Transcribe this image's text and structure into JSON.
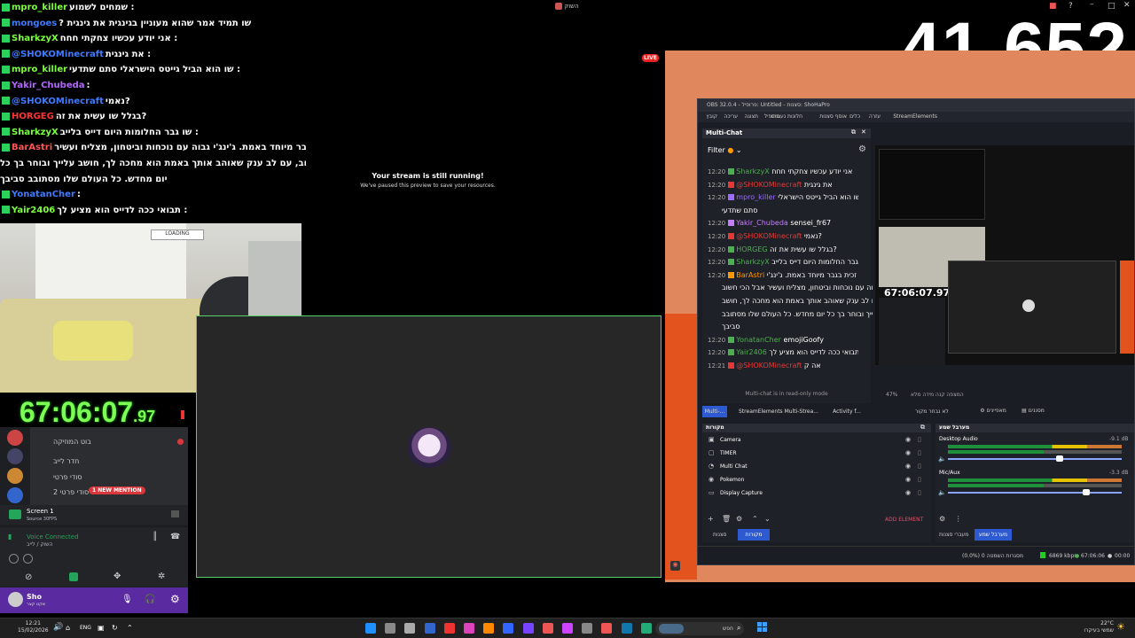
{
  "window": {
    "title": "השוק",
    "live_badge": "LIVE"
  },
  "chat": [
    {
      "name": "mpro_killer",
      "color": "#7cff3f",
      "msg": "שמחים לשמוע :"
    },
    {
      "name": "mongoes",
      "color": "#3f7bff",
      "msg": "? שו תמיד אמר שהוא מעוניין בגינגית את גינגית"
    },
    {
      "name": "SharkzyX",
      "color": "#7cff3f",
      "msg": "אני יודע עכשיו צחקתי חחח :"
    },
    {
      "name": "@SHOKOMinecraft",
      "color": "#3f7bff",
      "msg": "את גינגית :"
    },
    {
      "name": "mpro_killer",
      "color": "#7cff3f",
      "msg": "שו הוא הביל גייטס הישראלי סתם שתדעי :"
    },
    {
      "name": "Yakir_Chubeda",
      "color": "#b266ff",
      "msg": ":"
    },
    {
      "name": "@SHOKOMinecraft",
      "color": "#3f7bff",
      "msg": "נאמי?"
    },
    {
      "name": "HORGEG",
      "color": "#ff3333",
      "msg": "בגלל שו עשית את זה?"
    },
    {
      "name": "SharkzyX",
      "color": "#7cff3f",
      "msg": "שו גבר החלומות היום דייס בלייב :"
    },
    {
      "name": "BarAstri",
      "color": "#ff5555",
      "msg": "זכית בגבר מיוחד באמת. ג'ינג'י גבוה עם נוכחות וביטחון, מצליח ועשיר :"
    },
    {
      "name": "",
      "color": "#ffffff",
      "msg": "אבל הכי חשוב, עם לב ענק שאוהב אותך באמת הוא מחכה לך, חושב עלייך ובוחר בך כל"
    },
    {
      "name": "",
      "color": "#ffffff",
      "msg": "יום מחדש. כל העולם שלו מסתובב סביבך"
    },
    {
      "name": "YonatanCher",
      "color": "#3f7bff",
      "msg": ":"
    },
    {
      "name": "Yair2406",
      "color": "#7cff3f",
      "msg": "תבואי ככה לדייס הוא מציע לך :"
    }
  ],
  "webcam": {
    "overlay_label": "LOADING"
  },
  "viewer_count": "41,652",
  "timer": {
    "main": "67:06:07",
    "fraction": ".97"
  },
  "stream_status": {
    "title": "Your stream is still running!",
    "subtitle": "We've paused this preview to save your resources."
  },
  "discord": {
    "channel_items": [
      "בוט המוזיקה",
      "חדר לייב",
      "סודי פרטי",
      "סודי פרטי 2"
    ],
    "mention_badge": "1 NEW MENTION",
    "screen_share": {
      "title": "Screen 1",
      "sub": "Source 30FPS"
    },
    "voice": {
      "status": "Voice Connected",
      "channel": "השוק / לייב"
    },
    "user": {
      "name": "Sho",
      "status": "שקט קצר"
    }
  },
  "obs": {
    "title": "OBS 32.0.4 - פרופיל: Untitled - סצנות: ShoHaPro",
    "menu": [
      "קובץ",
      "עריכה",
      "תצוגה",
      "פרופיל",
      "חלונות נעגנים",
      "אוסף סצנות",
      "כלים",
      "עזרה",
      "StreamElements"
    ],
    "multichat": {
      "title": "Multi-Chat",
      "filter": "Filter",
      "readonly": "Multi-chat is in read-only mode",
      "messages": [
        {
          "time": "12:20",
          "name": "SharkzyX",
          "color": "#4caf50",
          "msg": "אני יודע עכשיו צחקתי חחח"
        },
        {
          "time": "12:20",
          "name": "@SHOKOMinecraft",
          "color": "#e53935",
          "msg": "את גינגית"
        },
        {
          "time": "12:20",
          "name": "mpro_killer",
          "color": "#9c6bff",
          "msg": "שו הוא הביל גייטס הישראלי"
        },
        {
          "time": "",
          "name": "",
          "color": "#ffffff",
          "msg": "סתם שתדעי"
        },
        {
          "time": "12:20",
          "name": "Yakir_Chubeda",
          "color": "#c77dff",
          "msg": "sensei_fr67"
        },
        {
          "time": "12:20",
          "name": "@SHOKOMinecraft",
          "color": "#e53935",
          "msg": "נאמי?"
        },
        {
          "time": "12:20",
          "name": "HORGEG",
          "color": "#4caf50",
          "msg": "בגלל שו עשית את זה?"
        },
        {
          "time": "12:20",
          "name": "SharkzyX",
          "color": "#4caf50",
          "msg": "שו גבר החלומות היום דייס בלייב"
        },
        {
          "time": "12:20",
          "name": "BarAstri",
          "color": "#ff9800",
          "msg": "זכית בגבר מיוחד באמת. ג'ינג'י"
        },
        {
          "time": "",
          "name": "",
          "color": "#ffffff",
          "msg": "גבוה עם נוכחות וביטחון, מצליח ועשיר אבל הכי חשוב,"
        },
        {
          "time": "",
          "name": "",
          "color": "#ffffff",
          "msg": "עם לב ענק שאוהב אותך באמת הוא מחכה לך, חושב"
        },
        {
          "time": "",
          "name": "",
          "color": "#ffffff",
          "msg": "עלייך ובוחר בך כל יום מחדש. כל העולם שלו מסתובב"
        },
        {
          "time": "",
          "name": "",
          "color": "#ffffff",
          "msg": "סביבך"
        },
        {
          "time": "12:20",
          "name": "YonatanCher",
          "color": "#4caf50",
          "msg": "emojiGoofy"
        },
        {
          "time": "12:20",
          "name": "Yair2406",
          "color": "#4caf50",
          "msg": "תבואי ככה לדייס הוא מציע לך"
        },
        {
          "time": "12:21",
          "name": "@SHOKOMinecraft",
          "color": "#e53935",
          "msg": "אה ק"
        }
      ]
    },
    "dock_tabs": [
      "Multi-...",
      "StreamElements Multi-Strea...",
      "Activity f..."
    ],
    "preview_timer": "67:06:07.97",
    "preview_footer": "המצפה קנה מידה מלא",
    "preview_zoom": "47%",
    "source_buttons": {
      "no_source": "לא נבחר מקור",
      "properties": "מאפיינים",
      "filters": "מסננים"
    },
    "sources_header": "מקורות",
    "sources": [
      "Camera",
      "TIMER",
      "Multi Chat",
      "Pokemon",
      "Display Capture"
    ],
    "add_element": "ADD ELEMENT",
    "bottom_tabs": [
      "סצנות",
      "מקורות"
    ],
    "mixer_header": "מערבל שמע",
    "mixer": [
      {
        "name": "Desktop Audio",
        "db": "-9.1 dB"
      },
      {
        "name": "Mic/Aux",
        "db": "-3.3 dB"
      }
    ],
    "mixer_tabs": [
      "מעברי סצנות",
      "מערבל שמע"
    ],
    "statusbar": {
      "frames": "(0.0%) מסגרות השמטה 0",
      "bitrate": "6869 kbps",
      "time": "67:06:06",
      "time2": "00:00"
    }
  },
  "taskbar": {
    "time": "12:21",
    "date": "15/02/2026",
    "lang": "ENG",
    "search": "חפש",
    "weather": "22°C",
    "weather_text": "שמשי בעיקרו"
  }
}
